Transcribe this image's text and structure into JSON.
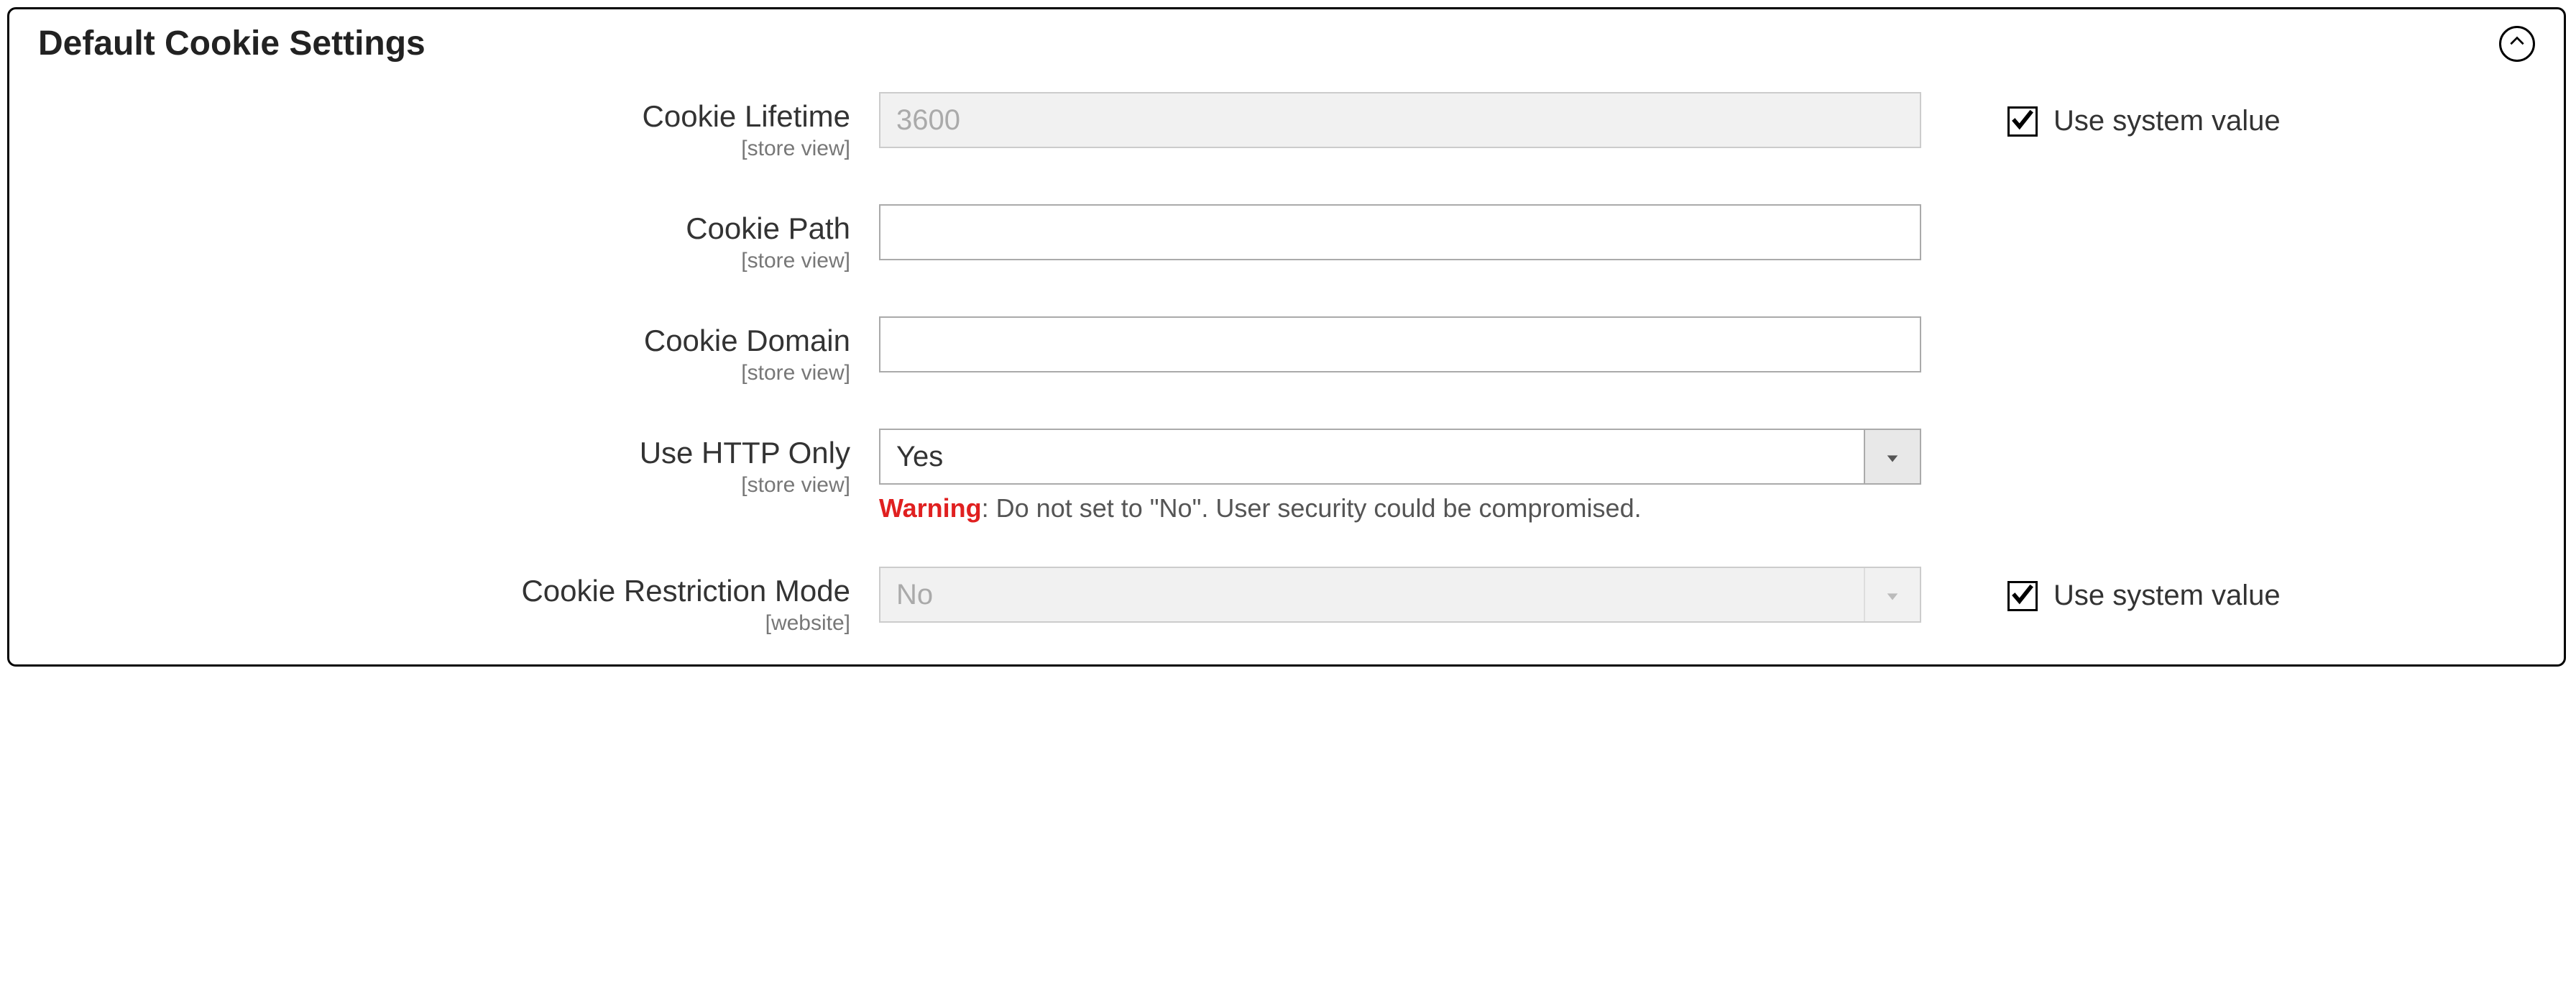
{
  "panel": {
    "title": "Default Cookie Settings"
  },
  "scopes": {
    "store_view": "[store view]",
    "website": "[website]"
  },
  "fields": {
    "cookie_lifetime": {
      "label": "Cookie Lifetime",
      "value": "3600",
      "use_system_label": "Use system value"
    },
    "cookie_path": {
      "label": "Cookie Path",
      "value": ""
    },
    "cookie_domain": {
      "label": "Cookie Domain",
      "value": ""
    },
    "use_http_only": {
      "label": "Use HTTP Only",
      "value": "Yes",
      "warning_prefix": "Warning",
      "warning_text": ": Do not set to \"No\". User security could be compromised."
    },
    "cookie_restriction_mode": {
      "label": "Cookie Restriction Mode",
      "value": "No",
      "use_system_label": "Use system value"
    }
  }
}
